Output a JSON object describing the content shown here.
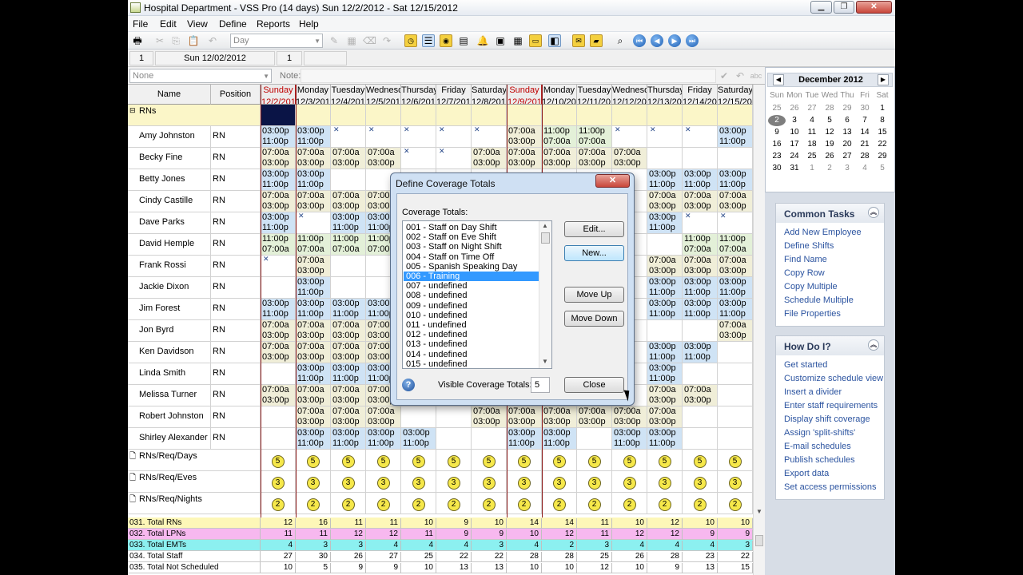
{
  "window": {
    "title": "Hospital Department - VSS Pro (14 days) Sun 12/2/2012 - Sat 12/15/2012"
  },
  "menu": [
    "File",
    "Edit",
    "View",
    "Define",
    "Reports",
    "Help"
  ],
  "toolbar": {
    "view_select": "Day"
  },
  "daterow": {
    "left_num": "1",
    "date": "Sun  12/02/2012",
    "right_num": "1"
  },
  "noterow": {
    "filter": "None",
    "note_label": "Note:"
  },
  "grid": {
    "name_header": "Name",
    "position_header": "Position",
    "days": [
      {
        "dow": "Sunday",
        "date": "12/2/2012"
      },
      {
        "dow": "Monday",
        "date": "12/3/2012"
      },
      {
        "dow": "Tuesday",
        "date": "12/4/2012"
      },
      {
        "dow": "Wednesday",
        "date": "12/5/2012"
      },
      {
        "dow": "Thursday",
        "date": "12/6/2012"
      },
      {
        "dow": "Friday",
        "date": "12/7/2012"
      },
      {
        "dow": "Saturday",
        "date": "12/8/2012"
      },
      {
        "dow": "Sunday",
        "date": "12/9/2012"
      },
      {
        "dow": "Monday",
        "date": "12/10/2012"
      },
      {
        "dow": "Tuesday",
        "date": "12/11/2012"
      },
      {
        "dow": "Wednesday",
        "date": "12/12/2012"
      },
      {
        "dow": "Thursday",
        "date": "12/13/2012"
      },
      {
        "dow": "Friday",
        "date": "12/14/2012"
      },
      {
        "dow": "Saturday",
        "date": "12/15/2012"
      }
    ],
    "group": "RNs",
    "employees": [
      {
        "name": "Amy Johnston",
        "position": "RN",
        "shifts": [
          "E",
          "E",
          "x",
          "x",
          "x",
          "x",
          "x",
          "D",
          "N",
          "N",
          "x",
          "x",
          "x",
          "E"
        ]
      },
      {
        "name": "Becky Fine",
        "position": "RN",
        "shifts": [
          "D",
          "D",
          "D",
          "D",
          "x",
          "x",
          "D",
          "D",
          "D",
          "D",
          "D",
          "",
          "",
          ""
        ]
      },
      {
        "name": "Betty Jones",
        "position": "RN",
        "shifts": [
          "E",
          "E",
          "",
          "",
          "",
          "",
          "",
          "",
          "",
          "",
          "",
          "E",
          "E",
          "E"
        ]
      },
      {
        "name": "Cindy Castille",
        "position": "RN",
        "shifts": [
          "D",
          "D",
          "D",
          "D",
          "",
          "",
          "",
          "",
          "",
          "",
          "",
          "D",
          "D",
          "D"
        ]
      },
      {
        "name": "Dave Parks",
        "position": "RN",
        "shifts": [
          "E",
          "x",
          "E",
          "E",
          "",
          "",
          "",
          "",
          "",
          "",
          "",
          "E",
          "x",
          "x"
        ]
      },
      {
        "name": "David Hemple",
        "position": "RN",
        "shifts": [
          "N",
          "N",
          "N",
          "N",
          "",
          "",
          "",
          "",
          "",
          "",
          "",
          "",
          "N",
          "N"
        ]
      },
      {
        "name": "Frank Rossi",
        "position": "RN",
        "shifts": [
          "x",
          "D",
          "",
          "",
          "",
          "",
          "",
          "",
          "",
          "",
          "",
          "D",
          "D",
          "D"
        ]
      },
      {
        "name": "Jackie Dixon",
        "position": "RN",
        "shifts": [
          "",
          "E",
          "",
          "",
          "",
          "",
          "",
          "",
          "",
          "",
          "",
          "E",
          "E",
          "E"
        ]
      },
      {
        "name": "Jim Forest",
        "position": "RN",
        "shifts": [
          "E",
          "E",
          "E",
          "E",
          "",
          "",
          "",
          "",
          "",
          "",
          "",
          "E",
          "E",
          "E"
        ]
      },
      {
        "name": "Jon Byrd",
        "position": "RN",
        "shifts": [
          "D",
          "D",
          "D",
          "D",
          "",
          "",
          "",
          "",
          "",
          "",
          "",
          "",
          "",
          "D"
        ]
      },
      {
        "name": "Ken Davidson",
        "position": "RN",
        "shifts": [
          "D",
          "D",
          "D",
          "D",
          "",
          "",
          "",
          "",
          "",
          "",
          "",
          "E",
          "E",
          ""
        ]
      },
      {
        "name": "Linda Smith",
        "position": "RN",
        "shifts": [
          "",
          "E",
          "E",
          "E",
          "",
          "",
          "",
          "",
          "",
          "",
          "",
          "E",
          "",
          ""
        ]
      },
      {
        "name": "Melissa Turner",
        "position": "RN",
        "shifts": [
          "D",
          "D",
          "D",
          "D",
          "",
          "",
          "",
          "",
          "",
          "",
          "",
          "D",
          "D",
          ""
        ]
      },
      {
        "name": "Robert Johnston",
        "position": "RN",
        "shifts": [
          "",
          "D",
          "D",
          "D",
          "",
          "",
          "D",
          "D",
          "D",
          "D",
          "D",
          "D",
          "",
          ""
        ]
      },
      {
        "name": "Shirley Alexander",
        "position": "RN",
        "shifts": [
          "",
          "E",
          "E",
          "E",
          "E",
          "",
          "",
          "E",
          "E",
          "",
          "E",
          "E",
          "",
          ""
        ]
      }
    ],
    "requirements": [
      {
        "label": "RNs/Req/Days",
        "value": "5"
      },
      {
        "label": "RNs/Req/Eves",
        "value": "3"
      },
      {
        "label": "RNs/Req/Nights",
        "value": "2"
      }
    ],
    "shift_times": {
      "D": [
        "07:00a",
        "03:00p"
      ],
      "E": [
        "03:00p",
        "11:00p"
      ],
      "N": [
        "11:00p",
        "07:00a"
      ]
    },
    "shift_colors": {
      "D": "#f0eed8",
      "E": "#cfe3f5",
      "N": "#e3f0d8",
      "group": "#fbf6c8",
      "selected": "#0a1446"
    }
  },
  "totals": [
    {
      "label": "031. Total RNs",
      "color": "#fdf7b8",
      "values": [
        12,
        16,
        11,
        11,
        10,
        9,
        10,
        14,
        14,
        11,
        10,
        12,
        10,
        10
      ]
    },
    {
      "label": "032. Total LPNs",
      "color": "#f7b8ef",
      "values": [
        11,
        11,
        12,
        12,
        11,
        9,
        9,
        10,
        12,
        11,
        12,
        12,
        9,
        9
      ]
    },
    {
      "label": "033. Total EMTs",
      "color": "#8cf0f0",
      "values": [
        4,
        3,
        3,
        4,
        4,
        4,
        3,
        4,
        2,
        3,
        4,
        4,
        4,
        3
      ]
    },
    {
      "label": "034. Total Staff",
      "color": "#ffffff",
      "values": [
        27,
        30,
        26,
        27,
        25,
        22,
        22,
        28,
        28,
        25,
        26,
        28,
        23,
        22
      ]
    },
    {
      "label": "035. Total  Not Scheduled",
      "color": "#ffffff",
      "values": [
        10,
        5,
        9,
        9,
        10,
        13,
        13,
        10,
        10,
        12,
        10,
        9,
        13,
        15
      ]
    }
  ],
  "calendar": {
    "month": "December 2012",
    "dows": [
      "Sun",
      "Mon",
      "Tue",
      "Wed",
      "Thu",
      "Fri",
      "Sat"
    ],
    "weeks": [
      [
        "25",
        "26",
        "27",
        "28",
        "29",
        "30",
        "1"
      ],
      [
        "2",
        "3",
        "4",
        "5",
        "6",
        "7",
        "8"
      ],
      [
        "9",
        "10",
        "11",
        "12",
        "13",
        "14",
        "15"
      ],
      [
        "16",
        "17",
        "18",
        "19",
        "20",
        "21",
        "22"
      ],
      [
        "23",
        "24",
        "25",
        "26",
        "27",
        "28",
        "29"
      ],
      [
        "30",
        "31",
        "1",
        "2",
        "3",
        "4",
        "5"
      ]
    ]
  },
  "common_tasks": {
    "title": "Common Tasks",
    "items": [
      "Add New Employee",
      "Define Shifts",
      "Find Name",
      "Copy Row",
      "Copy Multiple",
      "Schedule Multiple",
      "File Properties"
    ]
  },
  "how_do_i": {
    "title": "How Do I?",
    "items": [
      "Get started",
      "Customize schedule view",
      "Insert a divider",
      "Enter staff requirements",
      "Display shift coverage",
      "Assign 'split-shifts'",
      "E-mail schedules",
      "Publish schedules",
      "Export data",
      "Set access permissions"
    ]
  },
  "dialog": {
    "title": "Define Coverage Totals",
    "list_label": "Coverage Totals:",
    "items": [
      "001 - Staff on Day Shift",
      "002 - Staff on Eve Shift",
      "003 - Staff on Night Shift",
      "004 - Staff on Time Off",
      "005 - Spanish Speaking Day",
      "006 - Training",
      "007 - undefined",
      "008 - undefined",
      "009 - undefined",
      "010 - undefined",
      "011 - undefined",
      "012 - undefined",
      "013 - undefined",
      "014 - undefined",
      "015 - undefined"
    ],
    "selected_index": 5,
    "buttons": {
      "edit": "Edit...",
      "new": "New...",
      "move_up": "Move Up",
      "move_down": "Move Down",
      "close": "Close"
    },
    "visible_label": "Visible Coverage Totals:",
    "visible_value": "5"
  }
}
